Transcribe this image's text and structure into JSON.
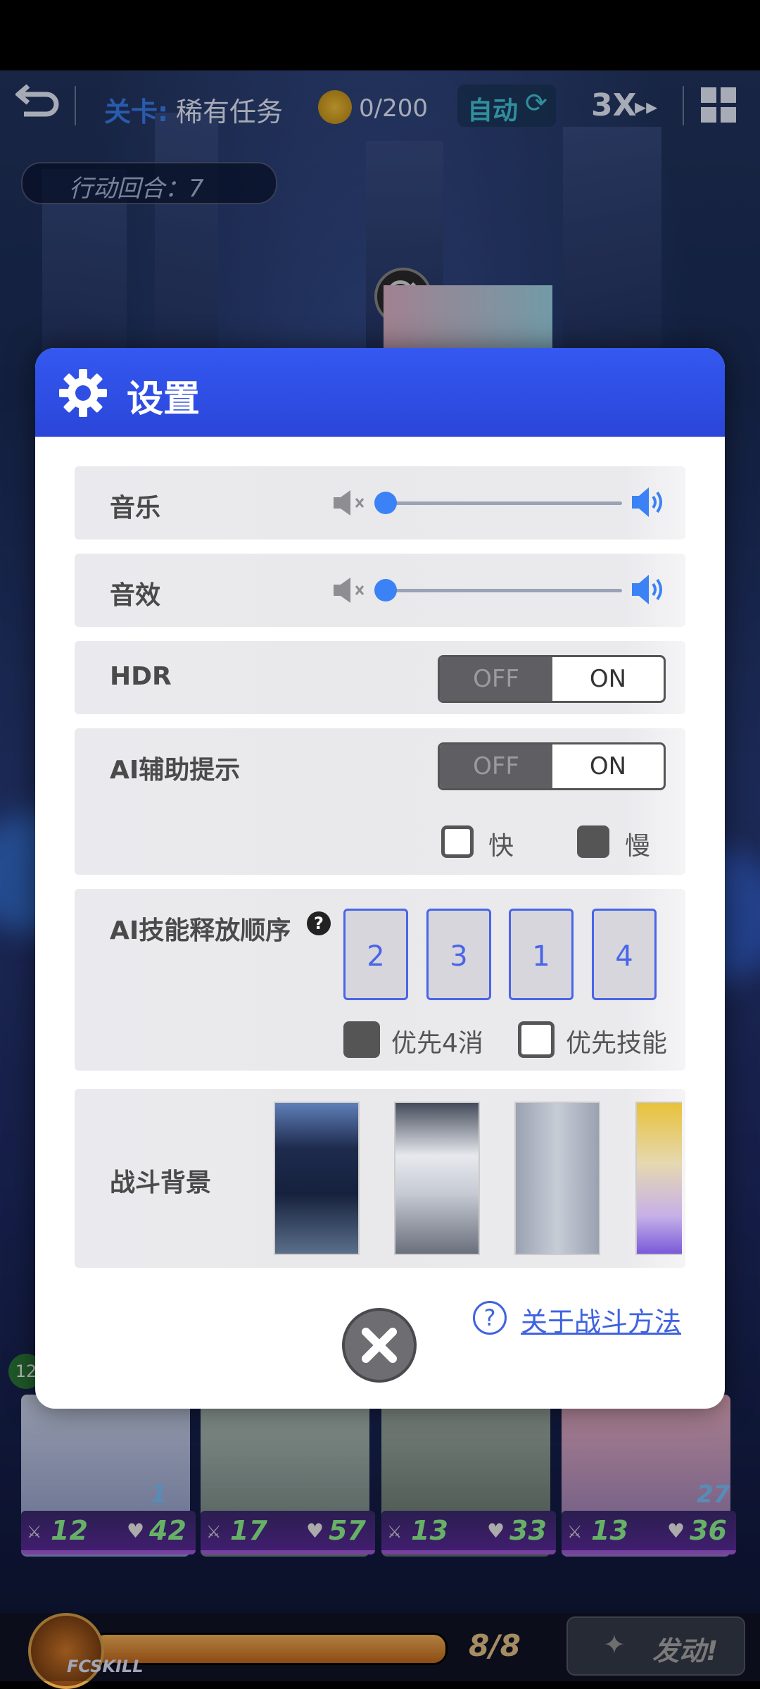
{
  "top_bar": {
    "level_label": "关卡:",
    "level_name": "稀有任务",
    "coins": "0/200",
    "auto_label": "自动",
    "speed_label": "3X"
  },
  "turn_indicator": "行动回合：7",
  "settings": {
    "title": "设置",
    "music": {
      "label": "音乐",
      "volume_fraction": 0
    },
    "sfx": {
      "label": "音效",
      "volume_fraction": 0
    },
    "hdr": {
      "label": "HDR",
      "off": "OFF",
      "on": "ON",
      "state": "ON"
    },
    "ai_hint": {
      "label": "AI辅助提示",
      "off": "OFF",
      "on": "ON",
      "state": "ON",
      "fast_label": "快",
      "slow_label": "慢",
      "fast_checked": false,
      "slow_checked": true
    },
    "ai_skill_order": {
      "label": "AI技能释放顺序",
      "help": "?",
      "order": [
        "2",
        "3",
        "1",
        "4"
      ],
      "prefer_4_match_label": "优先4消",
      "prefer_skill_label": "优先技能",
      "prefer_4_match_checked": true,
      "prefer_skill_checked": false
    },
    "battle_background": {
      "label": "战斗背景"
    },
    "help_link": "关于战斗方法"
  },
  "units": [
    {
      "speed": "12",
      "hp": "42"
    },
    {
      "speed": "17",
      "hp": "57"
    },
    {
      "speed": "13",
      "hp": "33"
    },
    {
      "speed": "13",
      "hp": "36"
    }
  ],
  "unit_shields": [
    "1",
    "27"
  ],
  "unit_level_badge": "12",
  "bottom_bar": {
    "fcskill": "FCSKILL",
    "energy": "8/8",
    "energy_fraction": 1.0,
    "launch": "发动!"
  }
}
